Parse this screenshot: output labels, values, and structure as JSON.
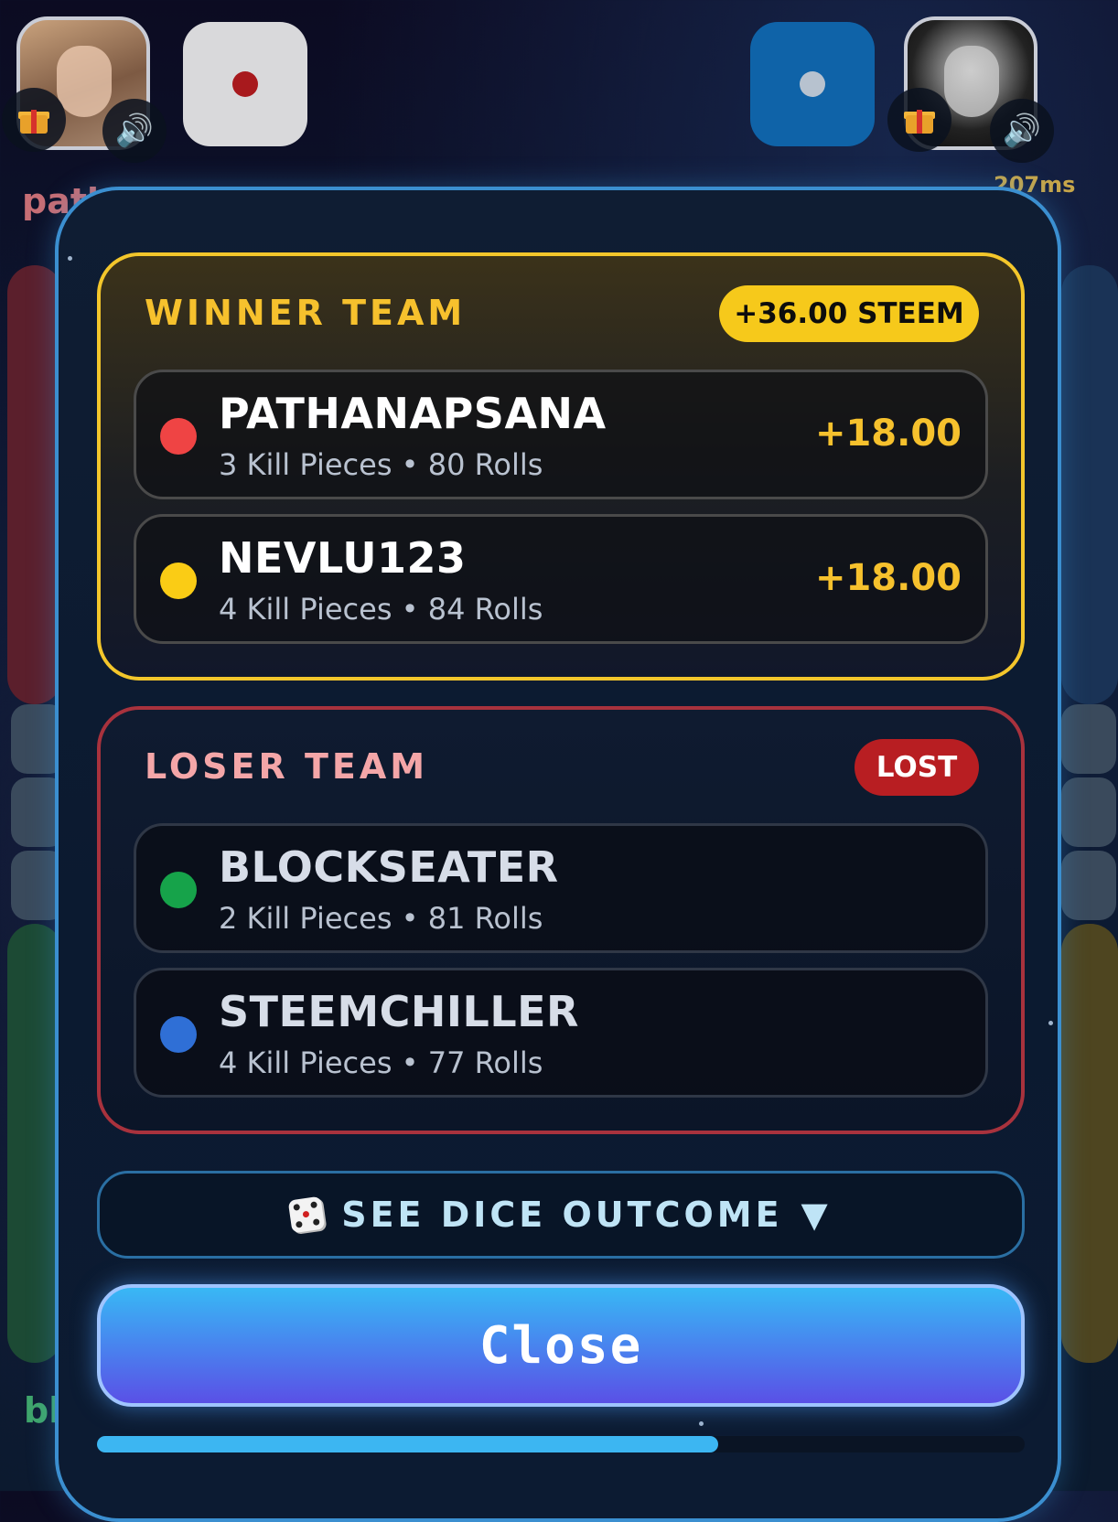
{
  "background": {
    "left_player_name": "patl",
    "right_player_name": "steemchiller",
    "ping": "207ms",
    "bottom_left_name": "bl"
  },
  "winner_team": {
    "title": "WINNER TEAM",
    "badge": "+36.00 STEEM",
    "players": [
      {
        "name": "PATHANAPSANA",
        "stats": "3 Kill Pieces • 80 Rolls",
        "amount": "+18.00",
        "color": "#ef4444"
      },
      {
        "name": "NEVLU123",
        "stats": "4 Kill Pieces • 84 Rolls",
        "amount": "+18.00",
        "color": "#facc15"
      }
    ]
  },
  "loser_team": {
    "title": "LOSER TEAM",
    "badge": "LOST",
    "players": [
      {
        "name": "BLOCKSEATER",
        "stats": "2 Kill Pieces • 81 Rolls",
        "color": "#16a34a"
      },
      {
        "name": "STEEMCHILLER",
        "stats": "4 Kill Pieces • 77 Rolls",
        "color": "#2f6fd6"
      }
    ]
  },
  "dice_outcome": {
    "label": "SEE DICE OUTCOME",
    "arrow": "▼",
    "icon": "dice-icon"
  },
  "close_button": {
    "label": "Close"
  },
  "progress": {
    "fraction": 0.67
  }
}
